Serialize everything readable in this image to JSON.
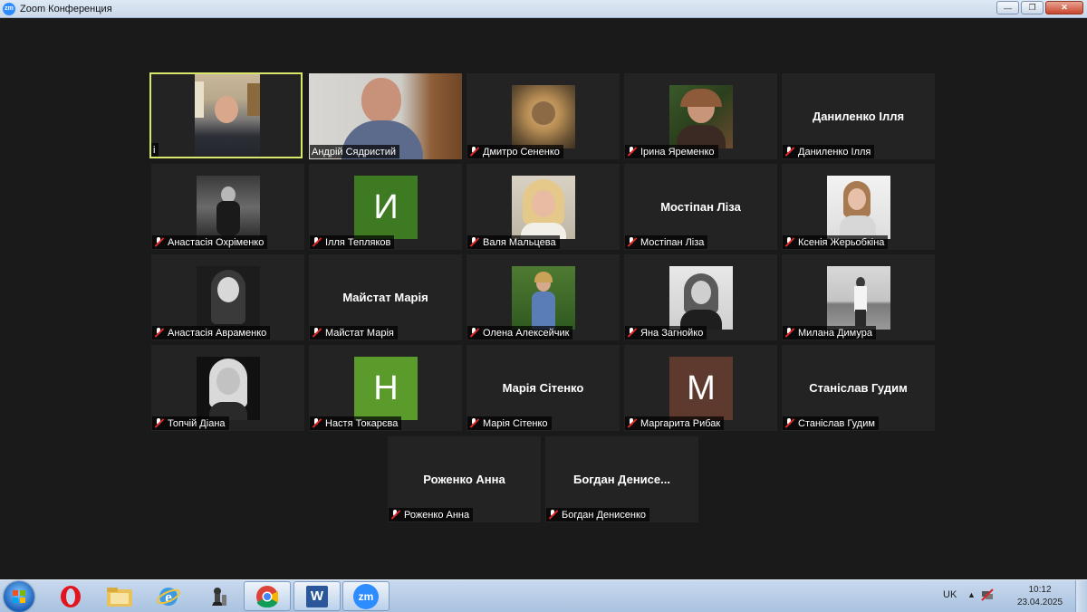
{
  "window": {
    "app_logo": "zm",
    "title": "Zoom Конференция",
    "minimize_label": "—",
    "maximize_label": "❐",
    "close_label": "✕"
  },
  "participants": [
    {
      "name": "i",
      "type": "video",
      "active": true
    },
    {
      "name": "Андрій Сядристий",
      "type": "video"
    },
    {
      "name": "Дмитро Сененко",
      "type": "photo",
      "muted": true
    },
    {
      "name": "Ірина Яременко",
      "type": "photo",
      "muted": true
    },
    {
      "name": "Даниленко Ілля",
      "type": "name",
      "display": "Даниленко Ілля",
      "muted": true
    },
    {
      "name": "Анастасія Охріменко",
      "type": "photo",
      "muted": true
    },
    {
      "name": "Ілля Тепляков",
      "type": "initial",
      "initial": "И",
      "color": "#3d7a22",
      "muted": true
    },
    {
      "name": "Валя Мальцева",
      "type": "photo",
      "muted": true
    },
    {
      "name": "Мостіпан Ліза",
      "type": "name",
      "display": "Мостіпан Ліза",
      "muted": true
    },
    {
      "name": "Ксенія Жерьобкіна",
      "type": "photo",
      "muted": true
    },
    {
      "name": "Анастасія Авраменко",
      "type": "photo",
      "muted": true
    },
    {
      "name": "Майстат Марія",
      "type": "name",
      "display": "Майстат Марія",
      "muted": true
    },
    {
      "name": "Олена Алексейчик",
      "type": "photo",
      "muted": true
    },
    {
      "name": "Яна Загнойко",
      "type": "photo",
      "muted": true
    },
    {
      "name": "Милана Димура",
      "type": "photo",
      "muted": true
    },
    {
      "name": "Топчій Діана",
      "type": "photo",
      "muted": true
    },
    {
      "name": "Настя Токарєва",
      "type": "initial",
      "initial": "Н",
      "color": "#5a9b2c",
      "muted": true
    },
    {
      "name": "Марія Сітенко",
      "type": "name",
      "display": "Марія Сітенко",
      "muted": true
    },
    {
      "name": "Маргарита Рибак",
      "type": "initial",
      "initial": "М",
      "color": "#5e3a2e",
      "muted": true
    },
    {
      "name": "Станіслав Гудим",
      "type": "name",
      "display": "Станіслав Гудим",
      "muted": true
    },
    {
      "name": "Роженко Анна",
      "type": "name",
      "display": "Роженко Анна",
      "muted": true
    },
    {
      "name": "Богдан Денисенко",
      "type": "name",
      "display": "Богдан  Денисе...",
      "muted": true
    }
  ],
  "taskbar": {
    "apps": [
      "Opera",
      "Explorer",
      "Internet Explorer",
      "Chess",
      "Chrome",
      "Word",
      "Zoom"
    ],
    "zoom_label": "zm",
    "word_label": "W"
  },
  "tray": {
    "language": "UK",
    "arrow": "▲",
    "time": "10:12",
    "date": "23.04.2025"
  }
}
